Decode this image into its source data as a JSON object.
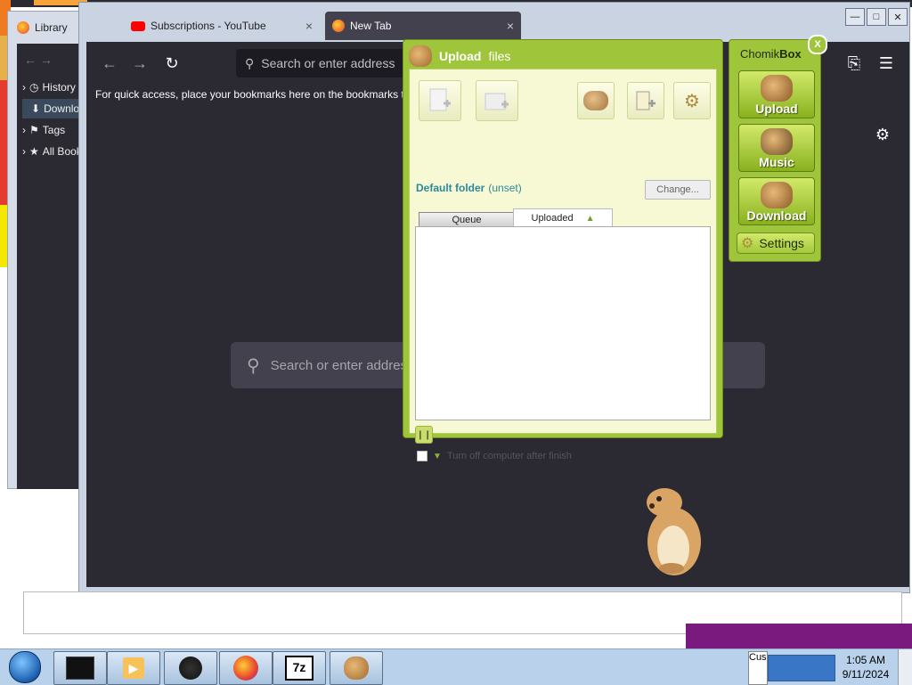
{
  "library": {
    "title": "Library",
    "items": [
      {
        "label": "History",
        "icon": "clock-icon"
      },
      {
        "label": "Downloads",
        "icon": "download-icon"
      },
      {
        "label": "Tags",
        "icon": "tag-icon"
      },
      {
        "label": "All Bookmarks",
        "icon": "star-icon"
      }
    ]
  },
  "browser": {
    "tabs": [
      {
        "label": "Subscriptions - YouTube",
        "close": "×"
      },
      {
        "label": "New Tab",
        "close": "×"
      }
    ],
    "url_placeholder": "Search or enter address",
    "bookmarks_hint": "For quick access, place your bookmarks here on the bookmarks to",
    "search_placeholder": "Search or enter address"
  },
  "upload": {
    "title_bold": "Upload",
    "title_rest": "files",
    "default_folder_label": "Default folder",
    "default_folder_value": "(unset)",
    "change_label": "Change...",
    "tab_queue": "Queue",
    "tab_uploaded": "Uploaded",
    "shutdown_label": "Turn off computer after finish"
  },
  "chomik": {
    "title_light": "Chomik",
    "title_bold": "Box",
    "close": "X",
    "buttons": [
      {
        "label": "Upload"
      },
      {
        "label": "Music"
      },
      {
        "label": "Download"
      }
    ],
    "settings_label": "Settings"
  },
  "taskbar": {
    "clock_time": "1:05 AM",
    "clock_date": "9/11/2024",
    "tray_text": "Cus",
    "sevenzip_label": "7z"
  },
  "colors": {
    "chomik_green": "#9fc53a",
    "dialog_bg": "#f7f9d4",
    "firefox_dark": "#2b2a33"
  }
}
